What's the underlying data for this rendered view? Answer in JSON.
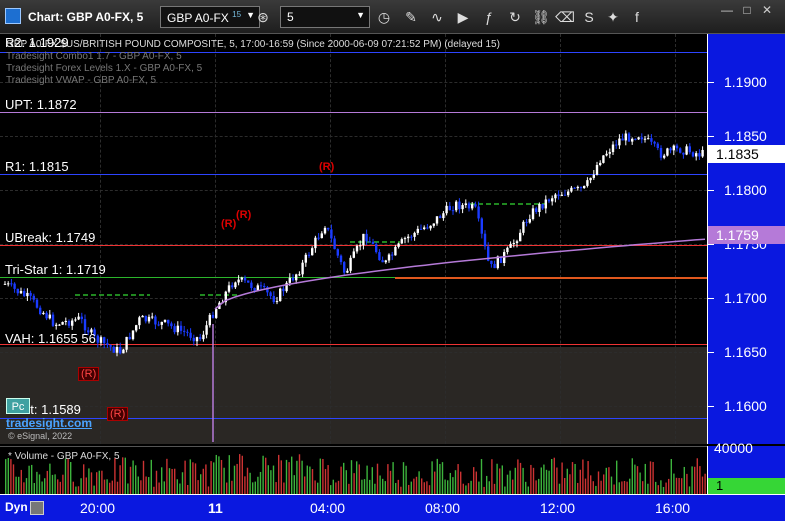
{
  "window": {
    "title": "Chart: GBP A0-FX, 5"
  },
  "toolbar": {
    "symbol": "GBP A0-FX",
    "symbol_superscript": "15",
    "interval": "5"
  },
  "chart": {
    "header_lines": [
      "GBP A0-FX $US/BRITISH POUND COMPOSITE, 5, 17:00-16:59 (Since 2000-06-09 07:21:52 PM) (delayed 15)",
      "Tradesight Combo1 1.7 - GBP A0-FX, 5",
      "Tradesight Forex Levels 1.X - GBP A0-FX, 5",
      "Tradesight VWAP - GBP A0-FX, 5"
    ],
    "levels": [
      {
        "label": "R2: 1.1929",
        "color": "#2d44ff"
      },
      {
        "label": "UPT: 1.1872",
        "color": "#b57ad8"
      },
      {
        "label": "R1: 1.1815",
        "color": "#2d44ff"
      },
      {
        "label": "UBreak: 1.1749",
        "color": "#e33"
      },
      {
        "label": "Tri-Star 1: 1.1719",
        "color": "#2bb52b"
      },
      {
        "label": "VAH: 1.1655",
        "color": "#e33"
      },
      {
        "label": "Pivot: 1.1589",
        "color": "#2d44ff"
      }
    ],
    "vah_suffix": "56",
    "r_marker": "(R)",
    "pc_badge": "Pc",
    "brand": "tradesight.com",
    "copyright": "© eSignal, 2022",
    "volume_title": "* Volume - GBP A0-FX, 5"
  },
  "price_axis": {
    "ticks": [
      "1.1900",
      "1.1850",
      "1.1800",
      "1.1750",
      "1.1700",
      "1.1650",
      "1.1600"
    ],
    "last_price": "1.1835",
    "vwap_price": "1.1759"
  },
  "volume_axis": {
    "top": "40000",
    "flag": "1"
  },
  "time_axis": {
    "labels": [
      "20:00",
      "11",
      "04:00",
      "08:00",
      "12:00",
      "16:00"
    ],
    "dyn": "Dyn"
  },
  "colors": {
    "axis_bg": "#0a18e0",
    "up": "#ffffff",
    "down": "#1a3bff",
    "vwap": "#b57ad8",
    "volume": "#3db33d"
  }
}
